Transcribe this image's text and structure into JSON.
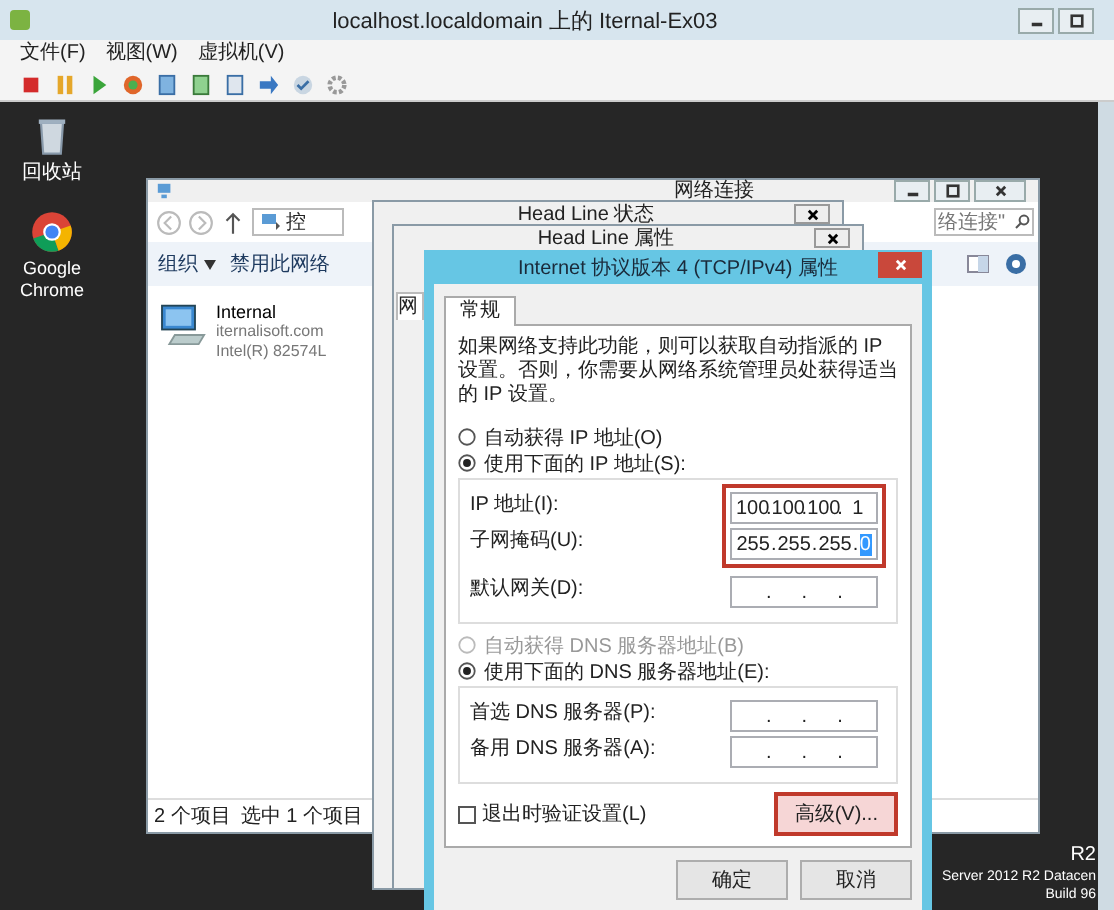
{
  "vm_window": {
    "title": "localhost.localdomain 上的 Iternal-Ex03",
    "menu": [
      "文件(F)",
      "视图(W)",
      "虚拟机(V)"
    ]
  },
  "desktop": {
    "icons": [
      {
        "label": "回收站",
        "kind": "recycle-bin"
      },
      {
        "label": "Google Chrome",
        "kind": "browser"
      }
    ],
    "edition_text": [
      "R2",
      "Server 2012 R2 Datacen",
      "Build 96"
    ]
  },
  "network_window": {
    "title": "网络连接",
    "address": "控",
    "search": {
      "placeholder": "络连接\""
    },
    "toolbar": [
      {
        "label": "组织",
        "has_menu": true
      },
      {
        "label": "禁用此网络",
        "has_menu": false
      }
    ],
    "connections": [
      {
        "name": "Internal",
        "domain": "iternalisoft.com",
        "adapter": "Intel(R) 82574L"
      }
    ],
    "status": [
      "2 个项目",
      "选中 1 个项目"
    ]
  },
  "status_window": {
    "title": "Head Line 状态"
  },
  "properties_window": {
    "title": "Head Line 属性",
    "tab": "网"
  },
  "ipv4_dialog": {
    "title": "Internet 协议版本 4 (TCP/IPv4) 属性",
    "tabs": [
      {
        "label": "常规",
        "selected": true
      }
    ],
    "description": "如果网络支持此功能，则可以获取自动指派的 IP 设置。否则，你需要从网络系统管理员处获得适当的 IP 设置。",
    "separator": ".",
    "ip_mode": [
      {
        "label": "自动获得 IP 地址(O)",
        "selected": false,
        "disabled": false
      },
      {
        "label": "使用下面的 IP 地址(S):",
        "selected": true,
        "disabled": false
      }
    ],
    "ip_fields": [
      {
        "label": "IP 地址(I):",
        "highlighted": true,
        "octets": [
          {
            "text": "100",
            "selected": false
          },
          {
            "text": "100",
            "selected": false
          },
          {
            "text": "100",
            "selected": false
          },
          {
            "text": "1",
            "selected": false
          }
        ]
      },
      {
        "label": "子网掩码(U):",
        "highlighted": true,
        "octets": [
          {
            "text": "255",
            "selected": false
          },
          {
            "text": "255",
            "selected": false
          },
          {
            "text": "255",
            "selected": false
          },
          {
            "text": "0",
            "selected": true
          }
        ]
      },
      {
        "label": "默认网关(D):",
        "highlighted": false
      }
    ],
    "dns_mode": [
      {
        "label": "自动获得 DNS 服务器地址(B)",
        "selected": false,
        "disabled": true
      },
      {
        "label": "使用下面的 DNS 服务器地址(E):",
        "selected": true,
        "disabled": false
      }
    ],
    "dns_fields": [
      {
        "label": "首选 DNS 服务器(P):",
        "highlighted": false
      },
      {
        "label": "备用 DNS 服务器(A):",
        "highlighted": false
      }
    ],
    "validate": {
      "label": "退出时验证设置(L)",
      "checked": false
    },
    "advanced_button": {
      "label": "高级(V)...",
      "highlighted": true
    },
    "buttons": [
      "确定",
      "取消"
    ]
  }
}
